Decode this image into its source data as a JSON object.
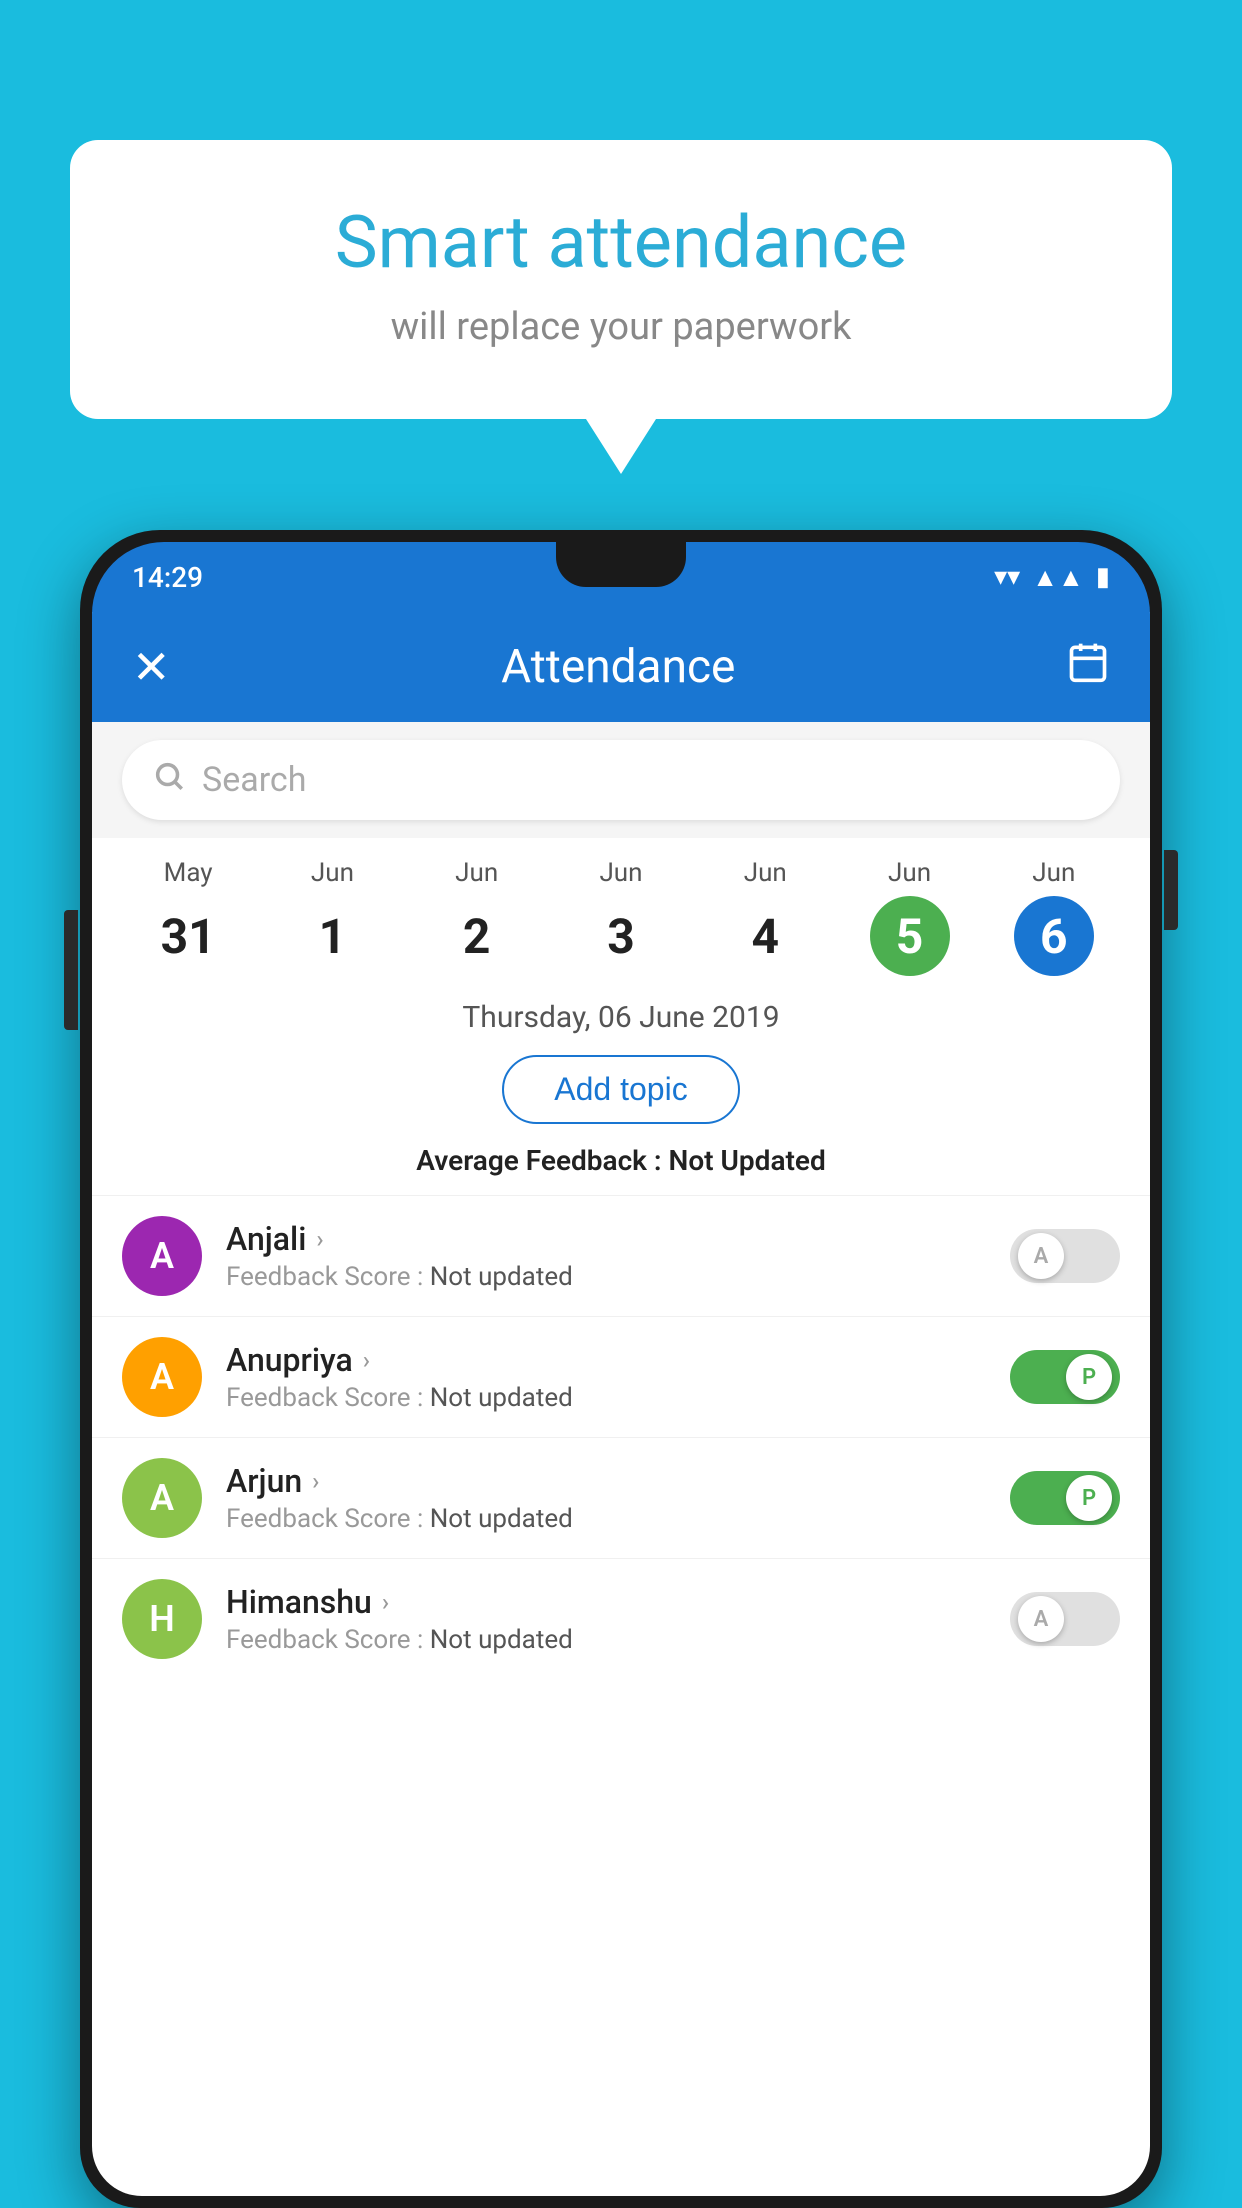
{
  "background_color": "#1ABCDE",
  "speech_bubble": {
    "title": "Smart attendance",
    "subtitle": "will replace your paperwork"
  },
  "status_bar": {
    "time": "14:29",
    "icons": [
      "wifi",
      "signal",
      "battery"
    ]
  },
  "app_header": {
    "title": "Attendance",
    "close_label": "✕",
    "calendar_icon": "📅"
  },
  "search": {
    "placeholder": "Search"
  },
  "calendar": {
    "days": [
      {
        "month": "May",
        "date": "31",
        "state": "normal"
      },
      {
        "month": "Jun",
        "date": "1",
        "state": "normal"
      },
      {
        "month": "Jun",
        "date": "2",
        "state": "normal"
      },
      {
        "month": "Jun",
        "date": "3",
        "state": "normal"
      },
      {
        "month": "Jun",
        "date": "4",
        "state": "normal"
      },
      {
        "month": "Jun",
        "date": "5",
        "state": "today"
      },
      {
        "month": "Jun",
        "date": "6",
        "state": "selected"
      }
    ]
  },
  "selected_date": "Thursday, 06 June 2019",
  "add_topic_label": "Add topic",
  "avg_feedback_label": "Average Feedback : ",
  "avg_feedback_value": "Not Updated",
  "students": [
    {
      "name": "Anjali",
      "initial": "A",
      "avatar_color": "#9C27B0",
      "feedback_label": "Feedback Score : ",
      "feedback_value": "Not updated",
      "attendance": "absent",
      "toggle_label": "A"
    },
    {
      "name": "Anupriya",
      "initial": "A",
      "avatar_color": "#FFA000",
      "feedback_label": "Feedback Score : ",
      "feedback_value": "Not updated",
      "attendance": "present",
      "toggle_label": "P"
    },
    {
      "name": "Arjun",
      "initial": "A",
      "avatar_color": "#8BC34A",
      "feedback_label": "Feedback Score : ",
      "feedback_value": "Not updated",
      "attendance": "present",
      "toggle_label": "P"
    },
    {
      "name": "Himanshu",
      "initial": "H",
      "avatar_color": "#8BC34A",
      "feedback_label": "Feedback Score : ",
      "feedback_value": "Not updated",
      "attendance": "absent",
      "toggle_label": "A"
    }
  ]
}
